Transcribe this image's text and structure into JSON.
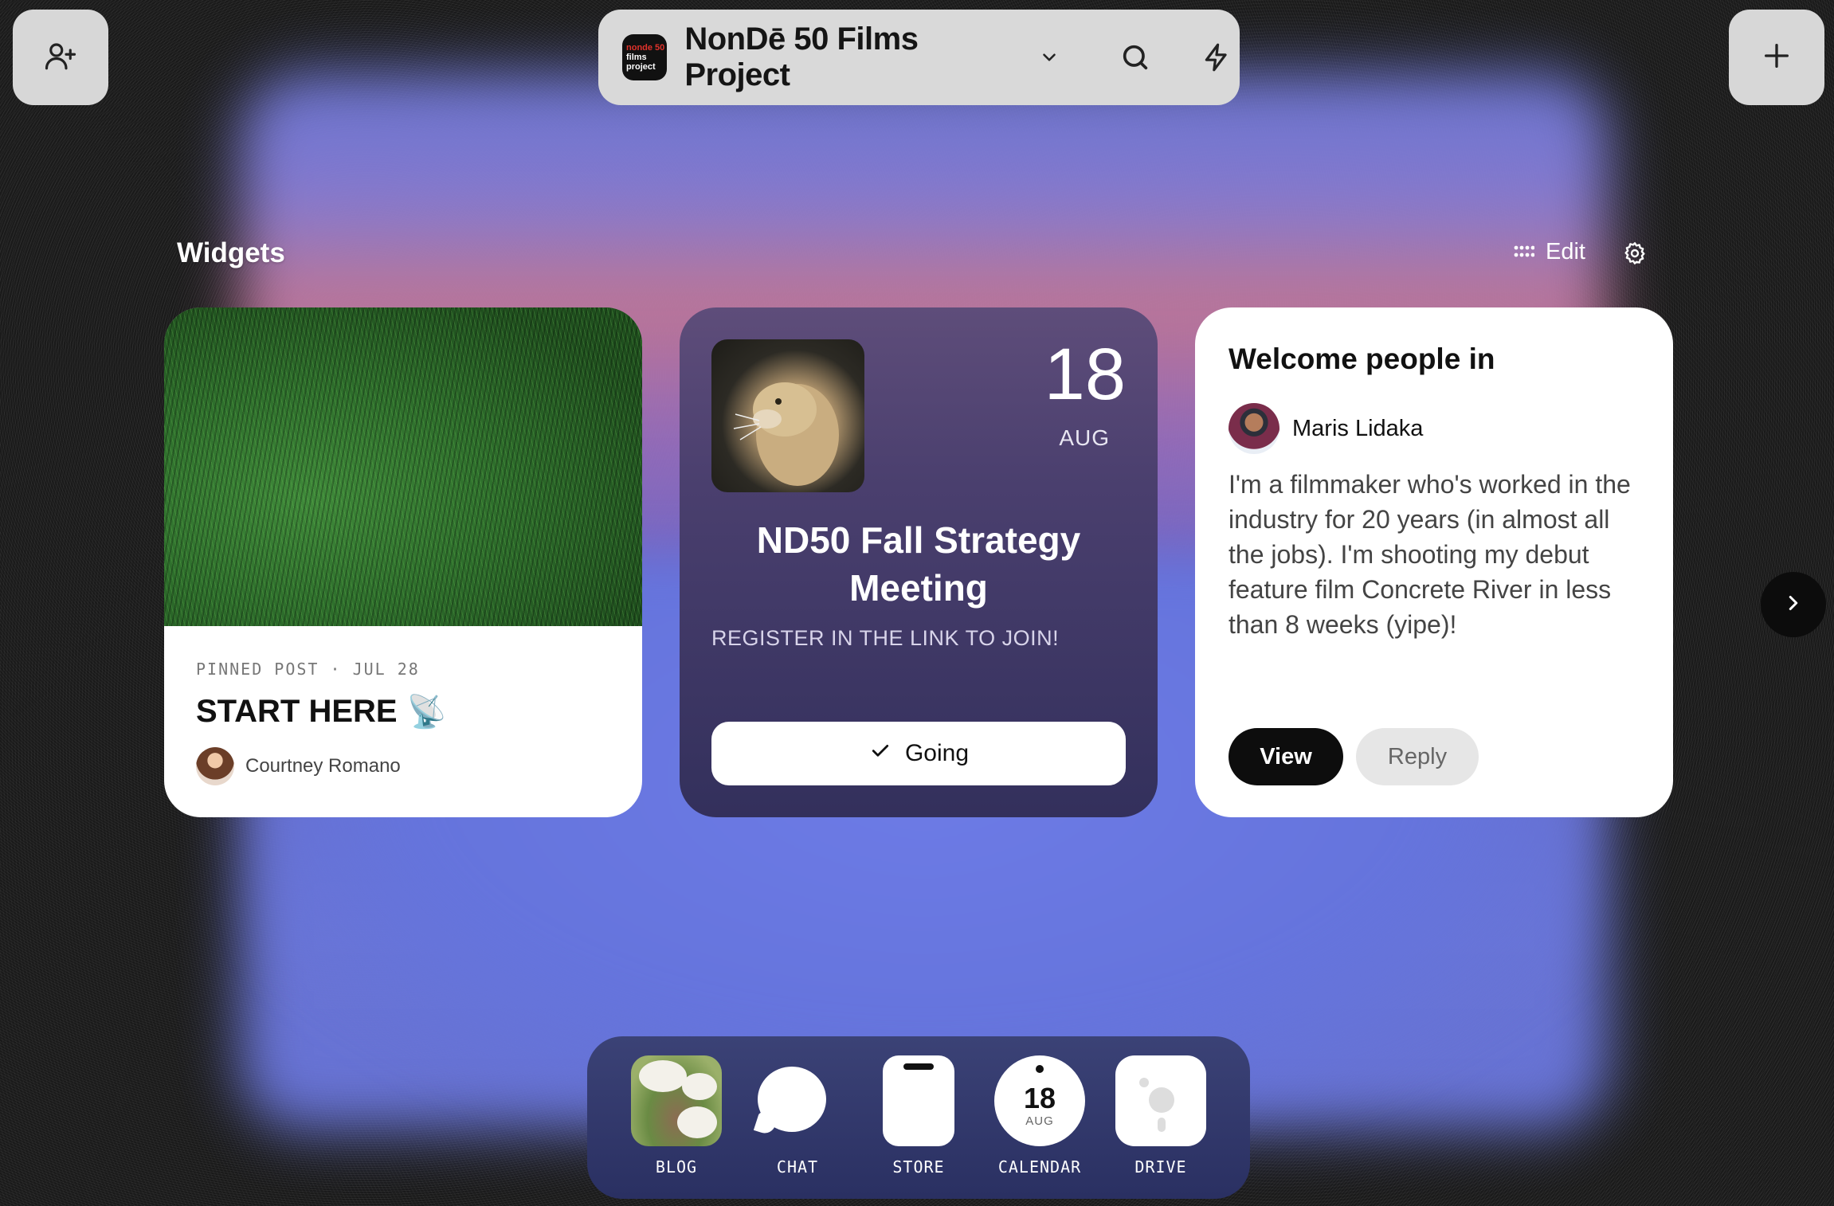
{
  "header": {
    "project_name": "NonDē 50 Films Project",
    "logo_lines": [
      "nonde 50",
      "films",
      "project"
    ]
  },
  "icons": {
    "add_member": "user-plus-icon",
    "create": "plus-icon",
    "dropdown": "chevron-down-icon",
    "search": "search-icon",
    "actions": "lightning-icon",
    "edit": "grid-dots-icon",
    "settings": "gear-icon",
    "next": "chevron-right-icon",
    "check": "check-icon",
    "pinned_emoji": "satellite-dish-icon"
  },
  "widgets": {
    "title": "Widgets",
    "edit_label": "Edit",
    "pinned": {
      "meta": "PINNED POST · JUL 28",
      "title": "START HERE",
      "emoji": "📡",
      "author": "Courtney Romano"
    },
    "event": {
      "day": "18",
      "month": "AUG",
      "title": "ND50 Fall Strategy Meeting",
      "subtitle": "REGISTER IN THE LINK TO JOIN!",
      "rsvp_label": "Going"
    },
    "welcome": {
      "title": "Welcome people in",
      "member_name": "Maris Lidaka",
      "intro": "I'm a filmmaker who's worked in the industry for 20 years (in almost all the jobs). I'm shooting my debut feature film Concrete River in less than 8 weeks (yipe)!",
      "view_label": "View",
      "reply_label": "Reply"
    }
  },
  "dock": {
    "apps": [
      {
        "label": "BLOG"
      },
      {
        "label": "CHAT"
      },
      {
        "label": "STORE"
      },
      {
        "label": "CALENDAR",
        "day": "18",
        "month": "AUG"
      },
      {
        "label": "DRIVE"
      }
    ]
  },
  "colors": {
    "dock_bg": "#2f3568",
    "event_card": "#3f3666",
    "primary_button": "#0d0d0d"
  }
}
